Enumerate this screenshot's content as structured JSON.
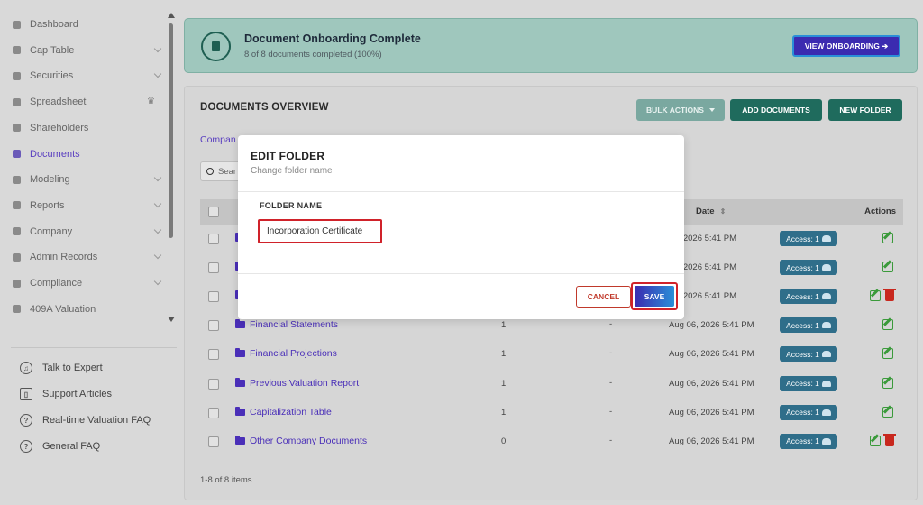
{
  "sidebar": {
    "items": [
      {
        "label": "Dashboard",
        "icon": "dashboard-icon",
        "chevron": false
      },
      {
        "label": "Cap Table",
        "icon": "pie-chart-icon",
        "chevron": true
      },
      {
        "label": "Securities",
        "icon": "clipboard-icon",
        "chevron": true
      },
      {
        "label": "Spreadsheet",
        "icon": "spreadsheet-icon",
        "badge": "♛"
      },
      {
        "label": "Shareholders",
        "icon": "user-icon",
        "chevron": false
      },
      {
        "label": "Documents",
        "icon": "folder-icon",
        "active": true
      },
      {
        "label": "Modeling",
        "icon": "lightbulb-icon",
        "chevron": true
      },
      {
        "label": "Reports",
        "icon": "report-icon",
        "chevron": true
      },
      {
        "label": "Company",
        "icon": "building-icon",
        "chevron": true
      },
      {
        "label": "Admin Records",
        "icon": "records-icon",
        "chevron": true
      },
      {
        "label": "Compliance",
        "icon": "shield-icon",
        "chevron": true
      },
      {
        "label": "409A Valuation",
        "icon": "chart-icon",
        "chevron": false
      }
    ],
    "help": [
      {
        "label": "Talk to Expert",
        "icon": "headset-icon",
        "glyph": "♫"
      },
      {
        "label": "Support Articles",
        "icon": "book-icon",
        "glyph": "▯"
      },
      {
        "label": "Real-time Valuation FAQ",
        "icon": "help-circle-icon",
        "glyph": "?"
      },
      {
        "label": "General FAQ",
        "icon": "help-circle-icon",
        "glyph": "?"
      }
    ]
  },
  "banner": {
    "title": "Document Onboarding Complete",
    "subtitle": "8 of 8 documents completed (100%)",
    "button": "VIEW ONBOARDING ➔"
  },
  "documents": {
    "title": "DOCUMENTS OVERVIEW",
    "bulk_actions": "BULK ACTIONS",
    "add_documents": "ADD DOCUMENTS",
    "new_folder": "NEW FOLDER",
    "breadcrumb": "Compan",
    "search_placeholder": "Sear",
    "col_date": "Date",
    "col_actions": "Actions",
    "rows": [
      {
        "name": "",
        "count": "",
        "dash": "",
        "date": "06, 2026 5:41 PM",
        "access": "Access: 1",
        "delete": false
      },
      {
        "name": "",
        "count": "",
        "dash": "",
        "date": "06, 2026 5:41 PM",
        "access": "Access: 1",
        "delete": false
      },
      {
        "name": "",
        "count": "",
        "dash": "",
        "date": "06, 2026 5:41 PM",
        "access": "Access: 1",
        "delete": true
      },
      {
        "name": "Financial Statements",
        "count": "1",
        "dash": "-",
        "date": "Aug 06, 2026 5:41 PM",
        "access": "Access: 1",
        "delete": false
      },
      {
        "name": "Financial Projections",
        "count": "1",
        "dash": "-",
        "date": "Aug 06, 2026 5:41 PM",
        "access": "Access: 1",
        "delete": false
      },
      {
        "name": "Previous Valuation Report",
        "count": "1",
        "dash": "-",
        "date": "Aug 06, 2026 5:41 PM",
        "access": "Access: 1",
        "delete": false
      },
      {
        "name": "Capitalization Table",
        "count": "1",
        "dash": "-",
        "date": "Aug 06, 2026 5:41 PM",
        "access": "Access: 1",
        "delete": false
      },
      {
        "name": "Other Company Documents",
        "count": "0",
        "dash": "-",
        "date": "Aug 06, 2026 5:41 PM",
        "access": "Access: 1",
        "delete": true
      }
    ],
    "footer": "1-8 of 8 items"
  },
  "modal": {
    "title": "EDIT FOLDER",
    "subtitle": "Change folder name",
    "field_label": "FOLDER NAME",
    "field_value": "Incorporation Certificate",
    "cancel": "CANCEL",
    "save": "SAVE"
  }
}
